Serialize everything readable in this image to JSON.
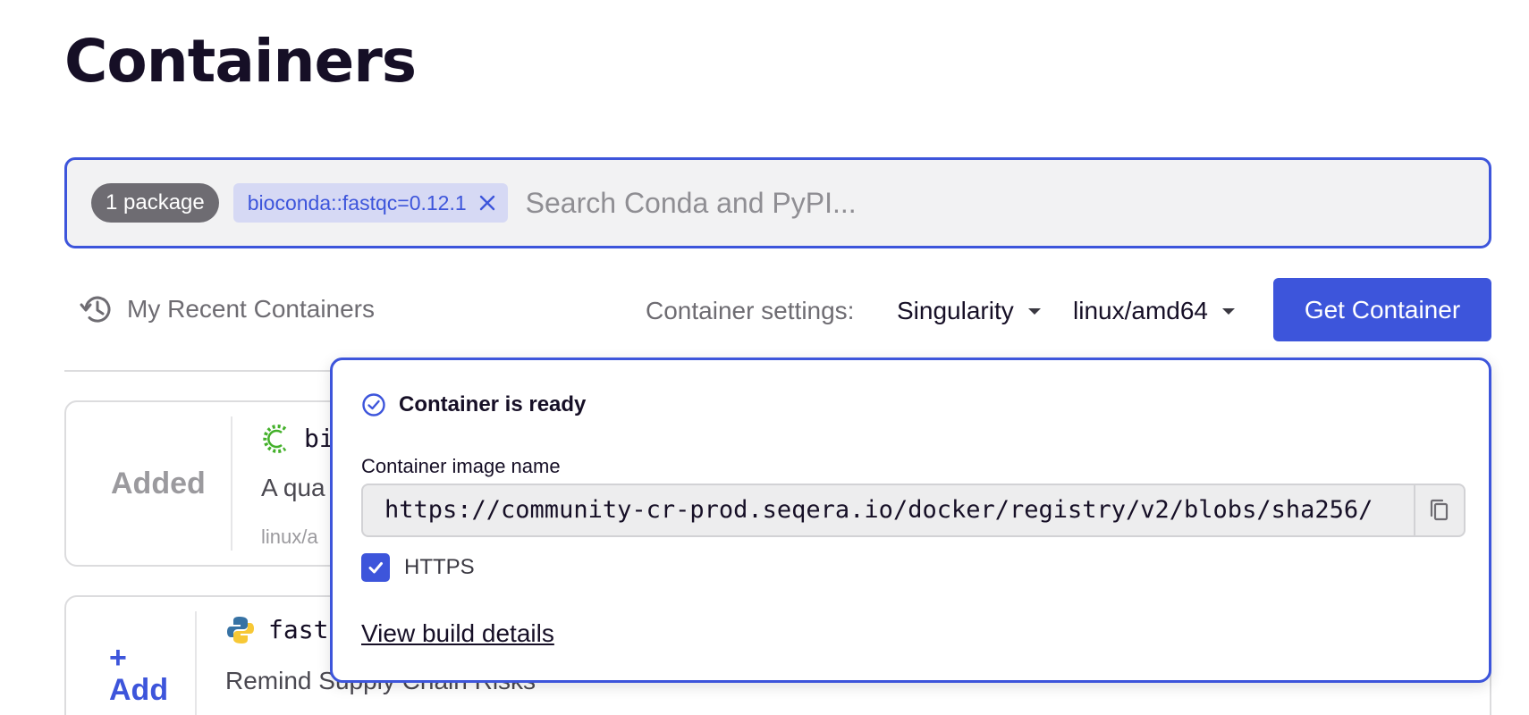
{
  "page": {
    "title": "Containers"
  },
  "search": {
    "package_count": "1 package",
    "selected_package": "bioconda::fastqc=0.12.1",
    "placeholder": "Search Conda and PyPI...",
    "value": ""
  },
  "toolbar": {
    "recent_label": "My Recent Containers",
    "settings_label": "Container settings:",
    "format": "Singularity",
    "platform": "linux/amd64",
    "get_button": "Get Container"
  },
  "results": [
    {
      "status": "Added",
      "name": "bi",
      "description": "A qua",
      "platform": "linux/a"
    },
    {
      "status_icon": "+",
      "status": "Add",
      "name": "fastq",
      "description": "Remind Supply Chain Risks"
    }
  ],
  "popover": {
    "ready_text": "Container is ready",
    "image_label": "Container image name",
    "image_value": "https://community-cr-prod.seqera.io/docker/registry/v2/blobs/sha256/",
    "https_label": "HTTPS",
    "https_checked": true,
    "build_link": "View build details"
  },
  "colors": {
    "accent": "#3d55db",
    "title": "#160f26",
    "muted": "#6e6c72",
    "chip_bg": "#d6d9f4"
  },
  "icons": [
    "history-icon",
    "close-icon",
    "chevron-down-icon",
    "conda-icon",
    "python-icon",
    "check-circle-icon",
    "copy-icon",
    "checkmark-icon"
  ]
}
